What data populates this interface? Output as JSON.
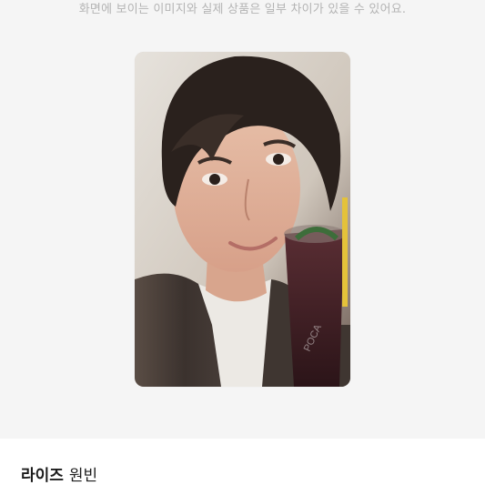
{
  "gallery": {
    "notice": "화면에 보이는 이미지와 실제 상품은 일부 차이가 있을 수 있어요.",
    "card_watermark": "POCA"
  },
  "product": {
    "brand": "라이즈",
    "name": "원빈"
  }
}
